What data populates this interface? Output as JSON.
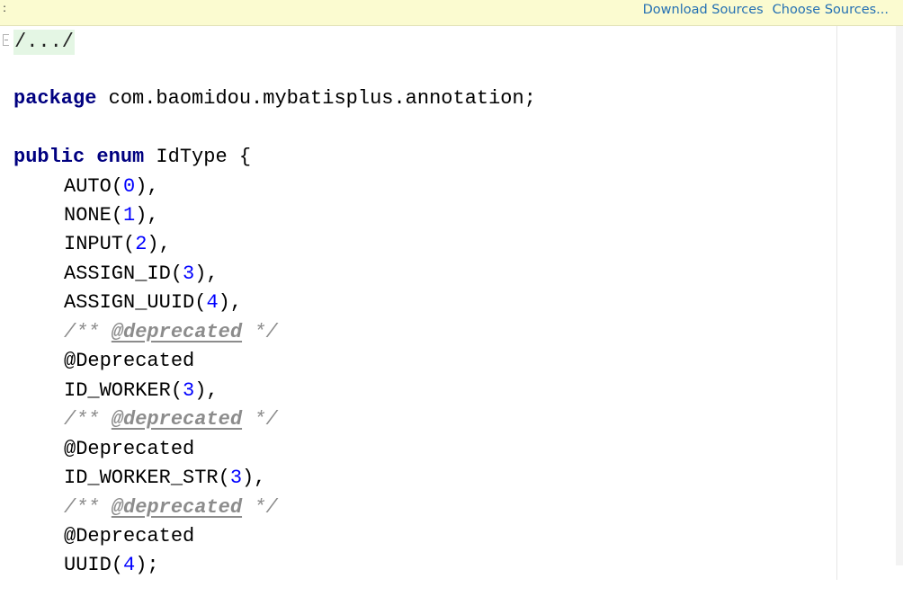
{
  "banner": {
    "mark": ":",
    "download_sources": "Download Sources",
    "choose_sources": "Choose Sources..."
  },
  "code": {
    "folded_header": "/.../",
    "package_keyword": "package",
    "package_name": " com.baomidou.mybatisplus.annotation;",
    "public_keyword": "public",
    "enum_keyword": "enum",
    "class_name": " IdType {",
    "entries": [
      {
        "name": "AUTO(",
        "value": "0",
        "suffix": "),"
      },
      {
        "name": "NONE(",
        "value": "1",
        "suffix": "),"
      },
      {
        "name": "INPUT(",
        "value": "2",
        "suffix": "),"
      },
      {
        "name": "ASSIGN_ID(",
        "value": "3",
        "suffix": "),"
      },
      {
        "name": "ASSIGN_UUID(",
        "value": "4",
        "suffix": "),"
      },
      {
        "name": "ID_WORKER(",
        "value": "3",
        "suffix": "),"
      },
      {
        "name": "ID_WORKER_STR(",
        "value": "3",
        "suffix": "),"
      },
      {
        "name": "UUID(",
        "value": "4",
        "suffix": ");"
      }
    ],
    "doc_open": "/** ",
    "doc_tag": "@deprecated",
    "doc_close": " */",
    "annotation": "@Deprecated"
  },
  "colors": {
    "banner_bg": "#fbfbd0",
    "link": "#2470b3",
    "keyword": "#000080",
    "number": "#0000ff",
    "comment": "#8c8c8c",
    "fold_bg": "#e4f6e4"
  }
}
